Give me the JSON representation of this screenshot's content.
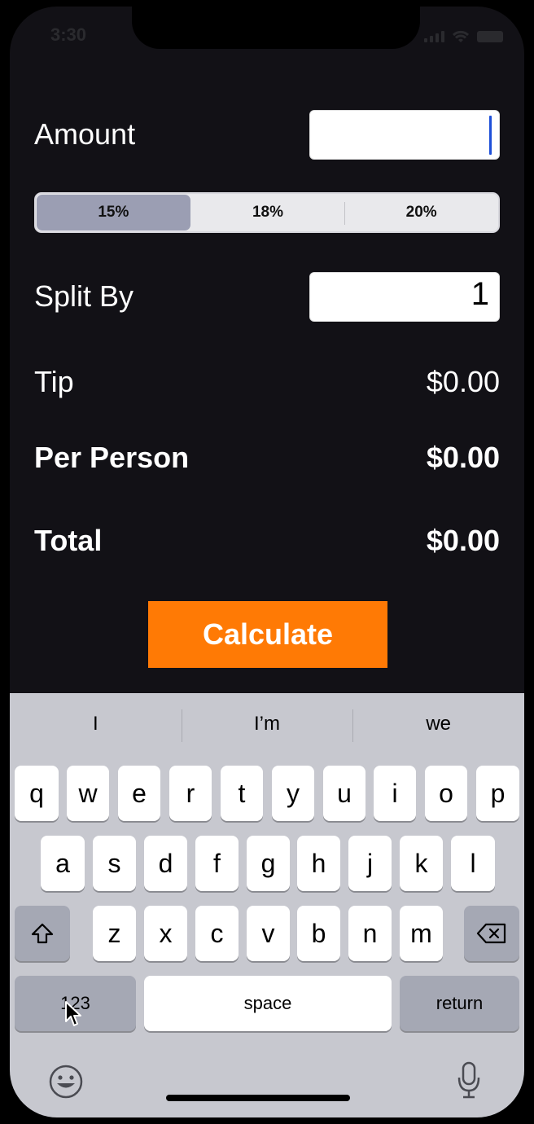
{
  "status": {
    "time": "3:30"
  },
  "amount": {
    "label": "Amount",
    "value": ""
  },
  "tip_segments": {
    "options": [
      "15%",
      "18%",
      "20%"
    ],
    "selected": "15%"
  },
  "split": {
    "label": "Split By",
    "value": "1"
  },
  "results": {
    "tip_label": "Tip",
    "tip_value": "$0.00",
    "per_person_label": "Per Person",
    "per_person_value": "$0.00",
    "total_label": "Total",
    "total_value": "$0.00"
  },
  "calculate_button": {
    "label": "Calculate"
  },
  "keyboard": {
    "suggestions": [
      "I",
      "I’m",
      "we"
    ],
    "row1": [
      "q",
      "w",
      "e",
      "r",
      "t",
      "y",
      "u",
      "i",
      "o",
      "p"
    ],
    "row2": [
      "a",
      "s",
      "d",
      "f",
      "g",
      "h",
      "j",
      "k",
      "l"
    ],
    "row3": [
      "z",
      "x",
      "c",
      "v",
      "b",
      "n",
      "m"
    ],
    "numbers_key": "123",
    "space_key": "space",
    "return_key": "return"
  },
  "colors": {
    "accent": "#ff7a05",
    "background": "#121116",
    "selected_segment": "#9b9eb3"
  }
}
